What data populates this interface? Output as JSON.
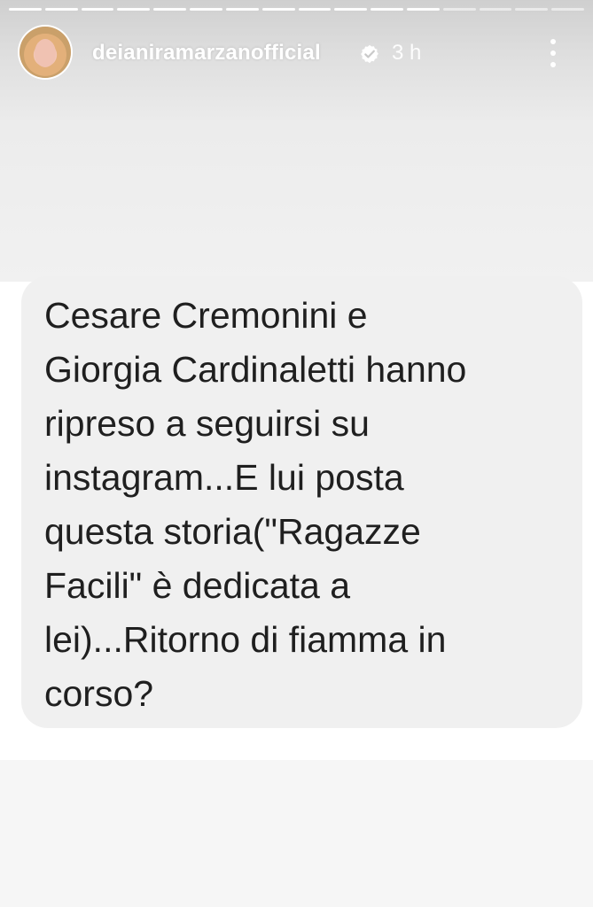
{
  "story": {
    "progress_segments": {
      "total": 16,
      "current": 12
    },
    "header": {
      "username": "deianiramarzanofficial",
      "time_ago": "3 h"
    },
    "message_lines": [
      "Cesare Cremonini e",
      "Giorgia Cardinaletti hanno",
      "ripreso a seguirsi su",
      "instagram...E lui posta",
      "questa storia(\"Ragazze",
      "Facili\" è dedicata a",
      "lei)...Ritorno di fiamma in",
      "corso?"
    ]
  },
  "colors": {
    "card_background": "#f0f0f0",
    "text": "#1f1f1f",
    "header_text": "#ffffff"
  },
  "icons": {
    "avatar": "profile-avatar",
    "verified": "verified-badge-icon",
    "more": "more-vertical-icon"
  }
}
